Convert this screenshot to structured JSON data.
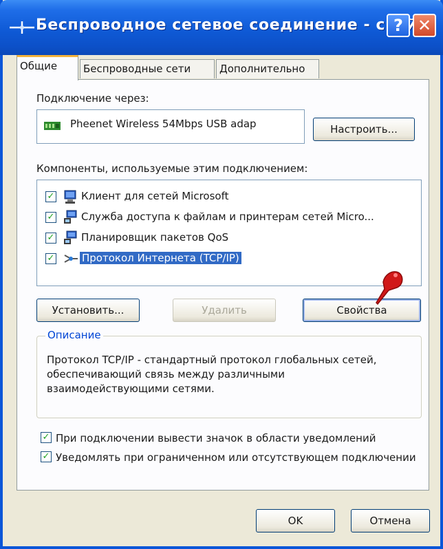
{
  "window": {
    "title": "Беспроводное сетевое соединение - свой...",
    "help_label": "?",
    "close_label": "✕"
  },
  "tabs": [
    {
      "label": "Общие",
      "active": true
    },
    {
      "label": "Беспроводные сети",
      "active": false
    },
    {
      "label": "Дополнительно",
      "active": false
    }
  ],
  "connect_via": {
    "label": "Подключение через:",
    "adapter_name": "Pheenet Wireless 54Mbps USB adap",
    "adapter_icon": "network-adapter-icon",
    "configure_button": "Настроить..."
  },
  "components": {
    "label": "Компоненты, используемые этим подключением:",
    "items": [
      {
        "label": "Клиент для сетей Microsoft",
        "checked": true,
        "icon": "network-client-icon",
        "selected": false
      },
      {
        "label": "Служба доступа к файлам и принтерам сетей Micro...",
        "checked": true,
        "icon": "network-service-icon",
        "selected": false
      },
      {
        "label": "Планировщик пакетов QoS",
        "checked": true,
        "icon": "network-service-icon",
        "selected": false
      },
      {
        "label": "Протокол Интернета (TCP/IP)",
        "checked": true,
        "icon": "network-protocol-icon",
        "selected": true
      }
    ]
  },
  "buttons": {
    "install": "Установить...",
    "uninstall": "Удалить",
    "properties": "Свойства",
    "ok": "OK",
    "cancel": "Отмена"
  },
  "description": {
    "title": "Описание",
    "text": "Протокол TCP/IP - стандартный протокол глобальных сетей, обеспечивающий связь между различными взаимодействующими сетями."
  },
  "options": [
    {
      "label": "При подключении вывести значок в области уведомлений",
      "checked": true
    },
    {
      "label": "Уведомлять при ограниченном или отсутствующем подключении",
      "checked": true
    }
  ],
  "colors": {
    "title_bar": "#0c50c8",
    "selection": "#316ac5",
    "pointer": "#d01818"
  }
}
